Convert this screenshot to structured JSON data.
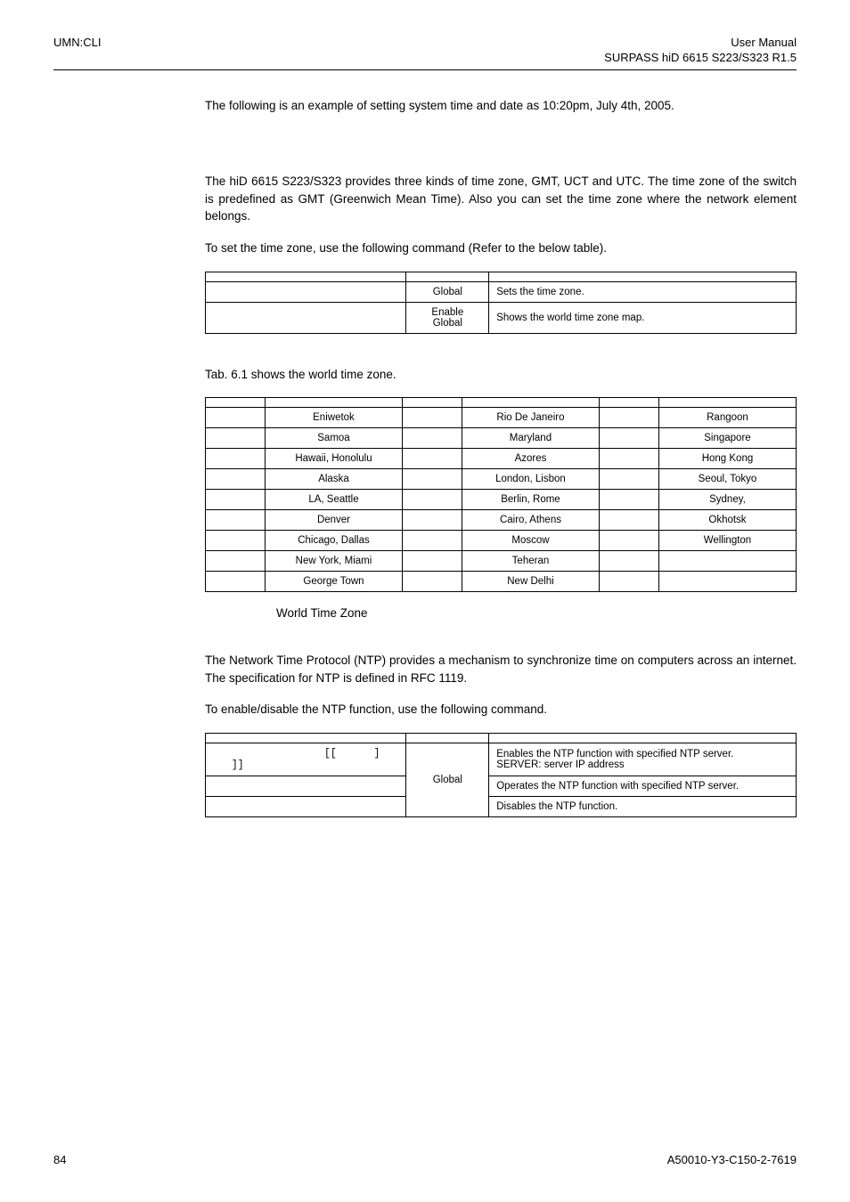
{
  "header": {
    "left": "UMN:CLI",
    "right_line1": "User Manual",
    "right_line2": "SURPASS hiD 6615 S223/S323 R1.5"
  },
  "intro_example": "The following is an example of setting system time and date as 10:20pm, July 4th, 2005.",
  "tz_intro_para1": "The hiD 6615 S223/S323 provides three kinds of time zone, GMT, UCT and UTC. The time zone of the switch is predefined as GMT (Greenwich Mean Time). Also you can set the time zone where the network element belongs.",
  "tz_intro_para2": "To set the time zone, use the following command (Refer to the below table).",
  "cmd_table1": {
    "headers": {
      "c1": "",
      "c2": "",
      "c3": ""
    },
    "rows": [
      {
        "cmd": "",
        "mode": "Global",
        "desc": "Sets the time zone."
      },
      {
        "cmd": "",
        "mode": "Enable\nGlobal",
        "desc": "Shows the world time zone map."
      }
    ]
  },
  "tz_shows_line": "Tab. 6.1 shows the world time zone.",
  "tz_table": {
    "headers": {
      "g": "",
      "c": ""
    },
    "rows": [
      {
        "g1": "",
        "c1": "Eniwetok",
        "g2": "",
        "c2": "Rio De Janeiro",
        "g3": "",
        "c3": "Rangoon"
      },
      {
        "g1": "",
        "c1": "Samoa",
        "g2": "",
        "c2": "Maryland",
        "g3": "",
        "c3": "Singapore"
      },
      {
        "g1": "",
        "c1": "Hawaii, Honolulu",
        "g2": "",
        "c2": "Azores",
        "g3": "",
        "c3": "Hong Kong"
      },
      {
        "g1": "",
        "c1": "Alaska",
        "g2": "",
        "c2": "London, Lisbon",
        "g3": "",
        "c3": "Seoul, Tokyo"
      },
      {
        "g1": "",
        "c1": "LA, Seattle",
        "g2": "",
        "c2": "Berlin, Rome",
        "g3": "",
        "c3": "Sydney,"
      },
      {
        "g1": "",
        "c1": "Denver",
        "g2": "",
        "c2": "Cairo, Athens",
        "g3": "",
        "c3": "Okhotsk"
      },
      {
        "g1": "",
        "c1": "Chicago, Dallas",
        "g2": "",
        "c2": "Moscow",
        "g3": "",
        "c3": "Wellington"
      },
      {
        "g1": "",
        "c1": "New York, Miami",
        "g2": "",
        "c2": "Teheran",
        "g3": "",
        "c3": ""
      },
      {
        "g1": "",
        "c1": "George Town",
        "g2": "",
        "c2": "New Delhi",
        "g3": "",
        "c3": ""
      }
    ]
  },
  "tab_caption": {
    "label": "",
    "text": "World Time Zone"
  },
  "ntp_para1": "The Network Time Protocol (NTP) provides a mechanism to synchronize time on computers across an internet. The specification for NTP is defined in RFC 1119.",
  "ntp_para2": "To enable/disable the NTP function, use the following command.",
  "ntp_table": {
    "headers": {
      "c1": "",
      "c2": "",
      "c3": ""
    },
    "rows": [
      {
        "cmd_a": "[[",
        "cmd_b": "]",
        "cmd_c": "]]",
        "desc1": "Enables the NTP function with specified NTP server.",
        "desc2": "SERVER: server IP address"
      },
      {
        "cmd": "",
        "desc": "Operates the NTP function with specified NTP server."
      },
      {
        "cmd": "",
        "desc": "Disables the NTP function."
      }
    ],
    "mode": "Global"
  },
  "footer": {
    "left": "84",
    "right": "A50010-Y3-C150-2-7619"
  }
}
